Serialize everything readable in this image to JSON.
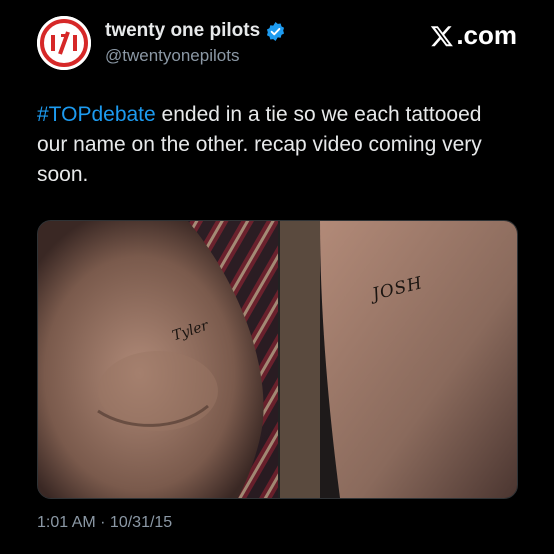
{
  "header": {
    "display_name": "twenty one pilots",
    "handle": "@twentyonepilots",
    "site_label": ".com",
    "logo": "x-logo-icon",
    "verified_badge": "verified-badge-icon",
    "avatar": "twenty-one-pilots-logo"
  },
  "tweet": {
    "hashtag": "#TOPdebate",
    "body": " ended in a tie so we each tattooed our name on the other. recap video coming very soon."
  },
  "media": {
    "left_tattoo": "Tyler",
    "right_tattoo": "JOSH"
  },
  "footer": {
    "timestamp": "1:01 AM · 10/31/15"
  },
  "colors": {
    "accent": "#1d9bf0",
    "background": "#000000",
    "logo_red": "#d62828"
  }
}
